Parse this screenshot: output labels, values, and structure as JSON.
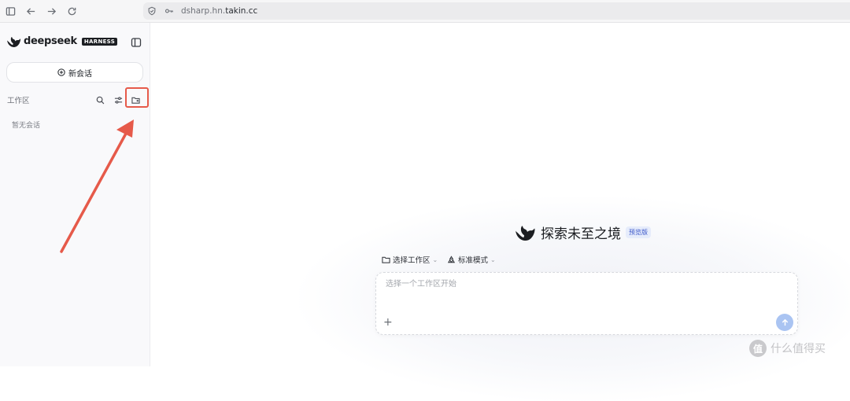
{
  "browser": {
    "url_prefix": "dsharp.hn.",
    "url_domain": "takin.cc"
  },
  "sidebar": {
    "logo_text": "deepseek",
    "logo_badge": "HARNESS",
    "new_chat_label": "新会话",
    "workspace_label": "工作区",
    "empty_text": "暂无会话"
  },
  "main": {
    "hero_title": "探索未至之境",
    "hero_badge": "预览版",
    "workspace_select_label": "选择工作区",
    "mode_select_label": "标准模式",
    "input_placeholder": "选择一个工作区开始",
    "input_value": ""
  },
  "watermark": {
    "logo": "值",
    "text": "什么值得买"
  },
  "colors": {
    "accent_red": "#e65a4a",
    "send_button": "#aac4f2",
    "badge_bg": "#e6ecfb",
    "badge_text": "#3a56c9"
  }
}
